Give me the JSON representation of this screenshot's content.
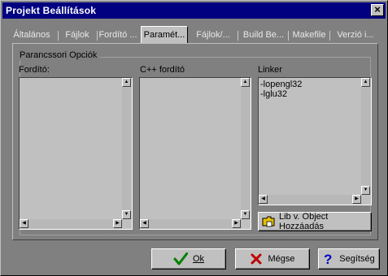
{
  "window": {
    "title": "Projekt Beállítások",
    "close_glyph": "×"
  },
  "tabs": [
    {
      "label": "Általános"
    },
    {
      "label": "Fájlok"
    },
    {
      "label": "Fordító ..."
    },
    {
      "label": "Paramét...",
      "active": true
    },
    {
      "label": "Fájlok/..."
    },
    {
      "label": "Build Be..."
    },
    {
      "label": "Makefile"
    },
    {
      "label": "Verzió i..."
    }
  ],
  "group": {
    "title": "Parancssori Opciók"
  },
  "lists": {
    "compiler": {
      "label": "Fordító:",
      "items": []
    },
    "cpp_compiler": {
      "label": "C++ fordító",
      "items": []
    },
    "linker": {
      "label": "Linker",
      "items": [
        "-lopengl32",
        "-lglu32"
      ]
    }
  },
  "buttons": {
    "add_lib": "Lib v. Object Hozzáadás",
    "ok": "Ok",
    "cancel": "Mégse",
    "help": "Segítség"
  },
  "colors": {
    "titlebar": "#000080",
    "background": "#808080",
    "control": "#c0c0c0",
    "ok_icon": "#008000",
    "cancel_icon": "#c00000",
    "help_icon": "#0000c0"
  }
}
